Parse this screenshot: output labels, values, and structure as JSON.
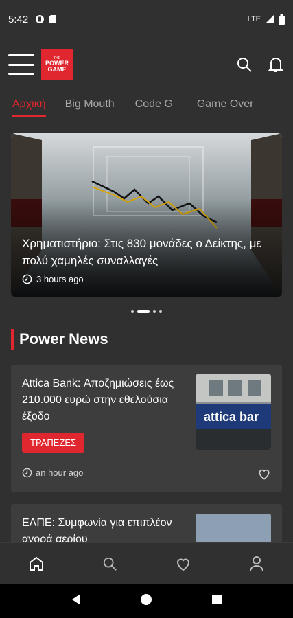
{
  "status_bar": {
    "time": "5:42",
    "network": "LTE"
  },
  "app_bar": {
    "logo": {
      "line1": "THE",
      "line2": "POWER",
      "line3": "GAME"
    }
  },
  "tabs": [
    {
      "label": "Αρχική",
      "active": true
    },
    {
      "label": "Big Mouth",
      "active": false
    },
    {
      "label": "Code G",
      "active": false
    },
    {
      "label": "Game Over",
      "active": false
    }
  ],
  "hero": {
    "title": "Χρηματιστήριο: Στις 830 μονάδες ο Δείκτης, με πολύ χαμηλές συναλλαγές",
    "time": "3 hours ago",
    "carousel_active_index": 1,
    "carousel_count": 4
  },
  "section": {
    "title": "Power News"
  },
  "articles": [
    {
      "title": "Attica Bank: Αποζημιώσεις έως 210.000 ευρώ στην εθελούσια έξοδο",
      "badge": "ΤΡΑΠΕΖΕΣ",
      "time": "an hour ago",
      "thumb_text": "attica bar"
    },
    {
      "title": "ΕΛΠΕ: Συμφωνία για επιπλέον αγορά αερίου"
    }
  ],
  "bottom_nav": [
    "home-icon",
    "search-icon",
    "heart-icon",
    "profile-icon"
  ],
  "colors": {
    "accent": "#e0262e",
    "background": "#303030",
    "card": "#3d3d3d"
  }
}
